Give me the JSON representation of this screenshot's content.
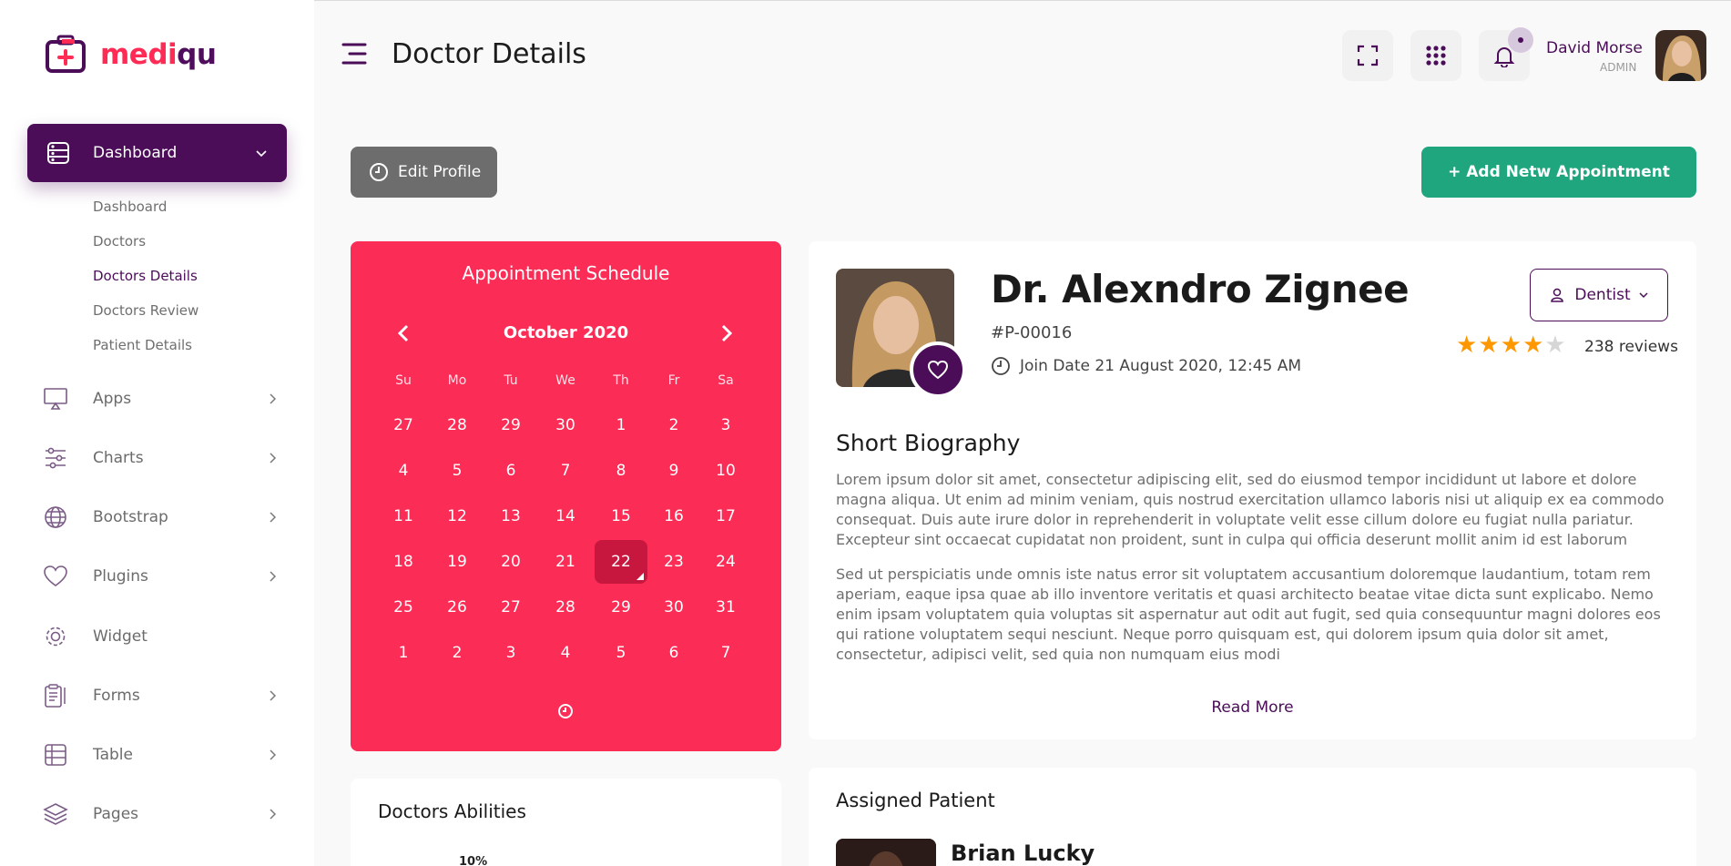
{
  "brand": {
    "name_part1": "medi",
    "name_part2": "qu",
    "accent": "#ff2b55",
    "primary": "#4b0d58"
  },
  "sidebar": {
    "active": {
      "label": "Dashboard",
      "icon": "dashboard-icon"
    },
    "submenu": [
      {
        "label": "Dashboard",
        "active": false
      },
      {
        "label": "Doctors",
        "active": false
      },
      {
        "label": "Doctors Details",
        "active": true
      },
      {
        "label": "Doctors Review",
        "active": false
      },
      {
        "label": "Patient Details",
        "active": false
      }
    ],
    "items": [
      {
        "label": "Apps",
        "icon": "monitor-icon",
        "has_children": true
      },
      {
        "label": "Charts",
        "icon": "sliders-icon",
        "has_children": true
      },
      {
        "label": "Bootstrap",
        "icon": "globe-icon",
        "has_children": true
      },
      {
        "label": "Plugins",
        "icon": "heart-icon",
        "has_children": true
      },
      {
        "label": "Widget",
        "icon": "settings-icon",
        "has_children": false
      },
      {
        "label": "Forms",
        "icon": "clipboard-icon",
        "has_children": true
      },
      {
        "label": "Table",
        "icon": "table-icon",
        "has_children": true
      },
      {
        "label": "Pages",
        "icon": "layers-icon",
        "has_children": true
      }
    ]
  },
  "header": {
    "title": "Doctor Details",
    "user": {
      "name": "David Morse",
      "role": "ADMIN"
    }
  },
  "actions": {
    "edit_profile": "Edit Profile",
    "add_appointment": "+ Add Netw Appointment",
    "edit_color": "#6d6d6d",
    "add_color": "#1fa67f"
  },
  "calendar": {
    "title": "Appointment Schedule",
    "month": "October 2020",
    "weekdays": [
      "Su",
      "Mo",
      "Tu",
      "We",
      "Th",
      "Fr",
      "Sa"
    ],
    "weeks": [
      [
        "27",
        "28",
        "29",
        "30",
        "1",
        "2",
        "3"
      ],
      [
        "4",
        "5",
        "6",
        "7",
        "8",
        "9",
        "10"
      ],
      [
        "11",
        "12",
        "13",
        "14",
        "15",
        "16",
        "17"
      ],
      [
        "18",
        "19",
        "20",
        "21",
        "22",
        "23",
        "24"
      ],
      [
        "25",
        "26",
        "27",
        "28",
        "29",
        "30",
        "31"
      ],
      [
        "1",
        "2",
        "3",
        "4",
        "5",
        "6",
        "7"
      ]
    ],
    "selected": "22",
    "color": "#fb2c55"
  },
  "doctor": {
    "name": "Dr. Alexndro Zignee",
    "id": "#P-00016",
    "join_date": "Join Date 21 August 2020, 12:45 AM",
    "specialty": "Dentist",
    "rating": 4,
    "rating_max": 5,
    "reviews": "238 reviews",
    "bio_title": "Short Biography",
    "bio_p1": "Lorem ipsum dolor sit amet, consectetur adipiscing elit, sed do eiusmod tempor incididunt ut labore et dolore magna aliqua. Ut enim ad minim veniam, quis nostrud exercitation ullamco laboris nisi ut aliquip ex ea commodo consequat. Duis aute irure dolor in reprehenderit in voluptate velit esse cillum dolore eu fugiat nulla pariatur. Excepteur sint occaecat cupidatat non proident, sunt in culpa qui officia deserunt mollit anim id est laborum",
    "bio_p2": "Sed ut perspiciatis unde omnis iste natus error sit voluptatem accusantium doloremque laudantium, totam rem aperiam, eaque ipsa quae ab illo inventore veritatis et quasi architecto beatae vitae dicta sunt explicabo. Nemo enim ipsam voluptatem quia voluptas sit aspernatur aut odit aut fugit, sed quia consequuntur magni dolores eos qui ratione voluptatem sequi nesciunt. Neque porro quisquam est, qui dolorem ipsum quia dolor sit amet, consectetur, adipisci velit, sed quia non numquam eius modi",
    "read_more": "Read More"
  },
  "abilities": {
    "title": "Doctors Abilities",
    "first_value": "10%"
  },
  "patients": {
    "title": "Assigned Patient",
    "first_name": "Brian Lucky"
  }
}
